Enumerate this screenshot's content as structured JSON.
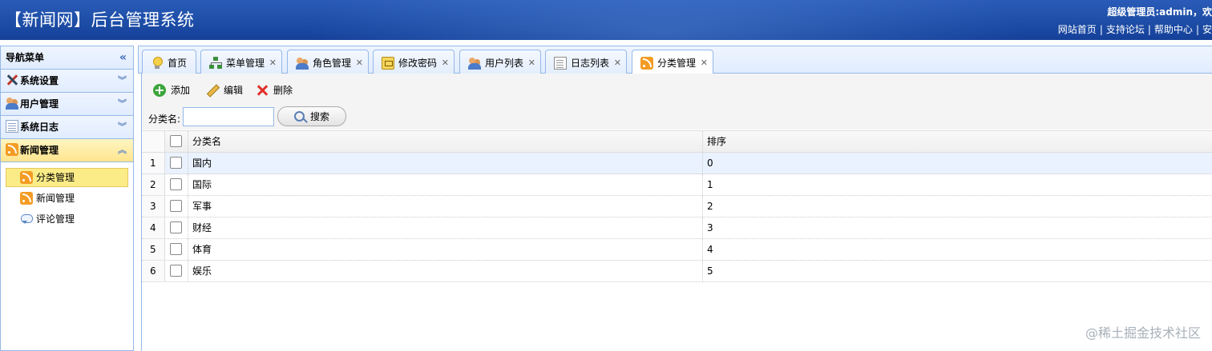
{
  "header": {
    "app_title": "【新闻网】后台管理系统",
    "welcome": "超级管理员:admin，欢",
    "links": [
      "网站首页",
      "支持论坛",
      "帮助中心",
      "安"
    ]
  },
  "sidebar": {
    "title": "导航菜单",
    "panels": [
      {
        "label": "系统设置",
        "icon": "tools-icon"
      },
      {
        "label": "用户管理",
        "icon": "users-icon"
      },
      {
        "label": "系统日志",
        "icon": "log-icon"
      },
      {
        "label": "新闻管理",
        "icon": "rss-icon"
      }
    ],
    "submenu": [
      {
        "label": "分类管理",
        "icon": "rss-icon"
      },
      {
        "label": "新闻管理",
        "icon": "rss-icon"
      },
      {
        "label": "评论管理",
        "icon": "comment-icon"
      }
    ]
  },
  "tabs": [
    {
      "label": "首页",
      "icon": "bulb-icon"
    },
    {
      "label": "菜单管理",
      "icon": "tree-icon"
    },
    {
      "label": "角色管理",
      "icon": "users-icon"
    },
    {
      "label": "修改密码",
      "icon": "key-icon"
    },
    {
      "label": "用户列表",
      "icon": "users-icon"
    },
    {
      "label": "日志列表",
      "icon": "doc-icon"
    },
    {
      "label": "分类管理",
      "icon": "rss-icon"
    }
  ],
  "toolbar": {
    "add_label": "添加",
    "edit_label": "编辑",
    "delete_label": "删除",
    "search_label": "分类名:",
    "search_value": "",
    "search_button": "搜索"
  },
  "grid": {
    "columns": [
      "分类名",
      "排序"
    ],
    "rows": [
      {
        "no": "1",
        "name": "国内",
        "sort": "0"
      },
      {
        "no": "2",
        "name": "国际",
        "sort": "1"
      },
      {
        "no": "3",
        "name": "军事",
        "sort": "2"
      },
      {
        "no": "4",
        "name": "财经",
        "sort": "3"
      },
      {
        "no": "5",
        "name": "体育",
        "sort": "4"
      },
      {
        "no": "6",
        "name": "娱乐",
        "sort": "5"
      }
    ]
  },
  "watermark": "@稀土掘金技术社区",
  "colors": {
    "header_bg": "#1e4fa8",
    "panel_border": "#95b8e7",
    "selected_bg": "#fbec88"
  }
}
